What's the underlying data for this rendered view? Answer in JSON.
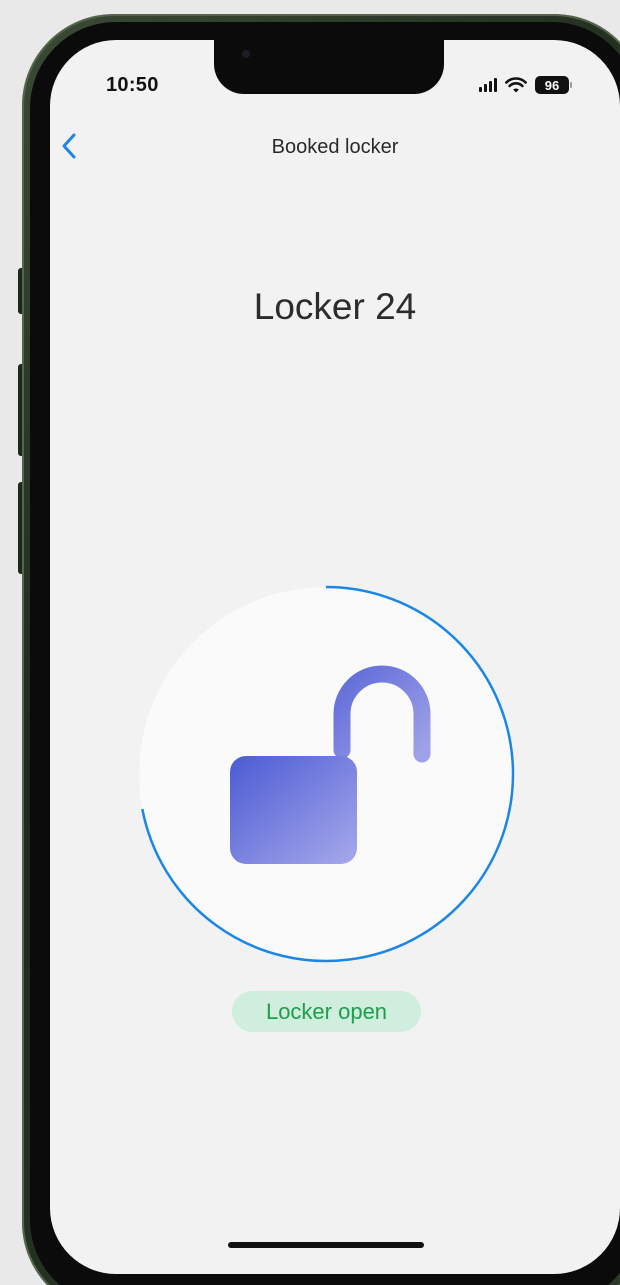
{
  "status_bar": {
    "time": "10:50",
    "battery": "96"
  },
  "nav": {
    "title": "Booked locker",
    "back_icon": "chevron-left-icon"
  },
  "locker": {
    "name": "Locker 24",
    "status": "Locker open",
    "lock_icon": "unlocked-padlock-icon",
    "progress_fraction": 0.72
  },
  "colors": {
    "accent": "#1a86e8",
    "status_text": "#1f9d4b",
    "status_bg": "#cfeedd",
    "lock_gradient_start": "#4b5bd4",
    "lock_gradient_end": "#a7a9ea"
  }
}
